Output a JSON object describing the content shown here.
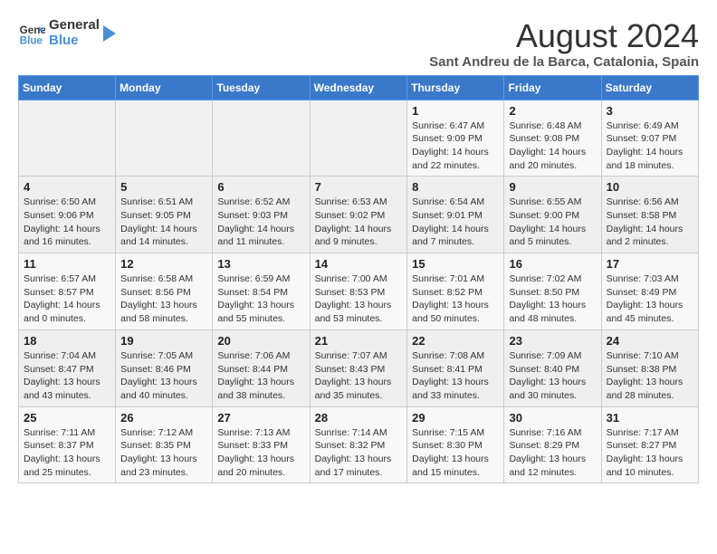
{
  "header": {
    "logo_line1": "General",
    "logo_line2": "Blue",
    "title": "August 2024",
    "subtitle": "Sant Andreu de la Barca, Catalonia, Spain"
  },
  "weekdays": [
    "Sunday",
    "Monday",
    "Tuesday",
    "Wednesday",
    "Thursday",
    "Friday",
    "Saturday"
  ],
  "weeks": [
    [
      {
        "day": "",
        "info": ""
      },
      {
        "day": "",
        "info": ""
      },
      {
        "day": "",
        "info": ""
      },
      {
        "day": "",
        "info": ""
      },
      {
        "day": "1",
        "info": "Sunrise: 6:47 AM\nSunset: 9:09 PM\nDaylight: 14 hours and 22 minutes."
      },
      {
        "day": "2",
        "info": "Sunrise: 6:48 AM\nSunset: 9:08 PM\nDaylight: 14 hours and 20 minutes."
      },
      {
        "day": "3",
        "info": "Sunrise: 6:49 AM\nSunset: 9:07 PM\nDaylight: 14 hours and 18 minutes."
      }
    ],
    [
      {
        "day": "4",
        "info": "Sunrise: 6:50 AM\nSunset: 9:06 PM\nDaylight: 14 hours and 16 minutes."
      },
      {
        "day": "5",
        "info": "Sunrise: 6:51 AM\nSunset: 9:05 PM\nDaylight: 14 hours and 14 minutes."
      },
      {
        "day": "6",
        "info": "Sunrise: 6:52 AM\nSunset: 9:03 PM\nDaylight: 14 hours and 11 minutes."
      },
      {
        "day": "7",
        "info": "Sunrise: 6:53 AM\nSunset: 9:02 PM\nDaylight: 14 hours and 9 minutes."
      },
      {
        "day": "8",
        "info": "Sunrise: 6:54 AM\nSunset: 9:01 PM\nDaylight: 14 hours and 7 minutes."
      },
      {
        "day": "9",
        "info": "Sunrise: 6:55 AM\nSunset: 9:00 PM\nDaylight: 14 hours and 5 minutes."
      },
      {
        "day": "10",
        "info": "Sunrise: 6:56 AM\nSunset: 8:58 PM\nDaylight: 14 hours and 2 minutes."
      }
    ],
    [
      {
        "day": "11",
        "info": "Sunrise: 6:57 AM\nSunset: 8:57 PM\nDaylight: 14 hours and 0 minutes."
      },
      {
        "day": "12",
        "info": "Sunrise: 6:58 AM\nSunset: 8:56 PM\nDaylight: 13 hours and 58 minutes."
      },
      {
        "day": "13",
        "info": "Sunrise: 6:59 AM\nSunset: 8:54 PM\nDaylight: 13 hours and 55 minutes."
      },
      {
        "day": "14",
        "info": "Sunrise: 7:00 AM\nSunset: 8:53 PM\nDaylight: 13 hours and 53 minutes."
      },
      {
        "day": "15",
        "info": "Sunrise: 7:01 AM\nSunset: 8:52 PM\nDaylight: 13 hours and 50 minutes."
      },
      {
        "day": "16",
        "info": "Sunrise: 7:02 AM\nSunset: 8:50 PM\nDaylight: 13 hours and 48 minutes."
      },
      {
        "day": "17",
        "info": "Sunrise: 7:03 AM\nSunset: 8:49 PM\nDaylight: 13 hours and 45 minutes."
      }
    ],
    [
      {
        "day": "18",
        "info": "Sunrise: 7:04 AM\nSunset: 8:47 PM\nDaylight: 13 hours and 43 minutes."
      },
      {
        "day": "19",
        "info": "Sunrise: 7:05 AM\nSunset: 8:46 PM\nDaylight: 13 hours and 40 minutes."
      },
      {
        "day": "20",
        "info": "Sunrise: 7:06 AM\nSunset: 8:44 PM\nDaylight: 13 hours and 38 minutes."
      },
      {
        "day": "21",
        "info": "Sunrise: 7:07 AM\nSunset: 8:43 PM\nDaylight: 13 hours and 35 minutes."
      },
      {
        "day": "22",
        "info": "Sunrise: 7:08 AM\nSunset: 8:41 PM\nDaylight: 13 hours and 33 minutes."
      },
      {
        "day": "23",
        "info": "Sunrise: 7:09 AM\nSunset: 8:40 PM\nDaylight: 13 hours and 30 minutes."
      },
      {
        "day": "24",
        "info": "Sunrise: 7:10 AM\nSunset: 8:38 PM\nDaylight: 13 hours and 28 minutes."
      }
    ],
    [
      {
        "day": "25",
        "info": "Sunrise: 7:11 AM\nSunset: 8:37 PM\nDaylight: 13 hours and 25 minutes."
      },
      {
        "day": "26",
        "info": "Sunrise: 7:12 AM\nSunset: 8:35 PM\nDaylight: 13 hours and 23 minutes."
      },
      {
        "day": "27",
        "info": "Sunrise: 7:13 AM\nSunset: 8:33 PM\nDaylight: 13 hours and 20 minutes."
      },
      {
        "day": "28",
        "info": "Sunrise: 7:14 AM\nSunset: 8:32 PM\nDaylight: 13 hours and 17 minutes."
      },
      {
        "day": "29",
        "info": "Sunrise: 7:15 AM\nSunset: 8:30 PM\nDaylight: 13 hours and 15 minutes."
      },
      {
        "day": "30",
        "info": "Sunrise: 7:16 AM\nSunset: 8:29 PM\nDaylight: 13 hours and 12 minutes."
      },
      {
        "day": "31",
        "info": "Sunrise: 7:17 AM\nSunset: 8:27 PM\nDaylight: 13 hours and 10 minutes."
      }
    ]
  ]
}
